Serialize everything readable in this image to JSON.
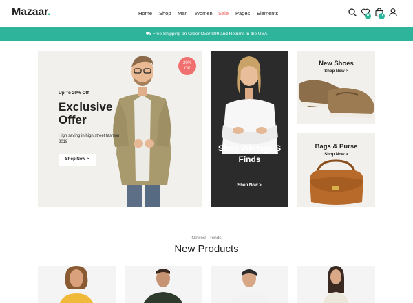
{
  "brand": {
    "name": "Mazaar",
    "dot": "."
  },
  "nav": [
    "Home",
    "Shop",
    "Man",
    "Women",
    "Sale",
    "Pages",
    "Elements"
  ],
  "icons": [
    "search-icon",
    "heart-icon",
    "cart-icon",
    "user-icon"
  ],
  "badges": {
    "wishlist": "0",
    "cart": "0"
  },
  "promo": "Free Shipping on Order Over $99 and Returns in the USA",
  "hero": {
    "subtitle": "Up To 20% Off",
    "title": "Exclusive Offer",
    "description": "Hign saving in hign street fashion 2018",
    "cta": "Shop Now >",
    "badge_line1": "20%",
    "badge_line2": "Off"
  },
  "middle_banner": {
    "title": "Shop Wintage S Finds",
    "cta": "Shop Now >"
  },
  "shoes_banner": {
    "title": "New Shoes",
    "cta": "Shop Now >"
  },
  "bags_banner": {
    "title": "Bags & Purse",
    "cta": "Shop Now >"
  },
  "section": {
    "subtitle": "Newest Trends",
    "title": "New Products"
  },
  "colors": {
    "accent": "#2fb49c",
    "sale": "#ef5b5b",
    "badge": "#f06f6f",
    "dark_banner": "#2b2b2b",
    "light_banner": "#f1f0ec"
  }
}
